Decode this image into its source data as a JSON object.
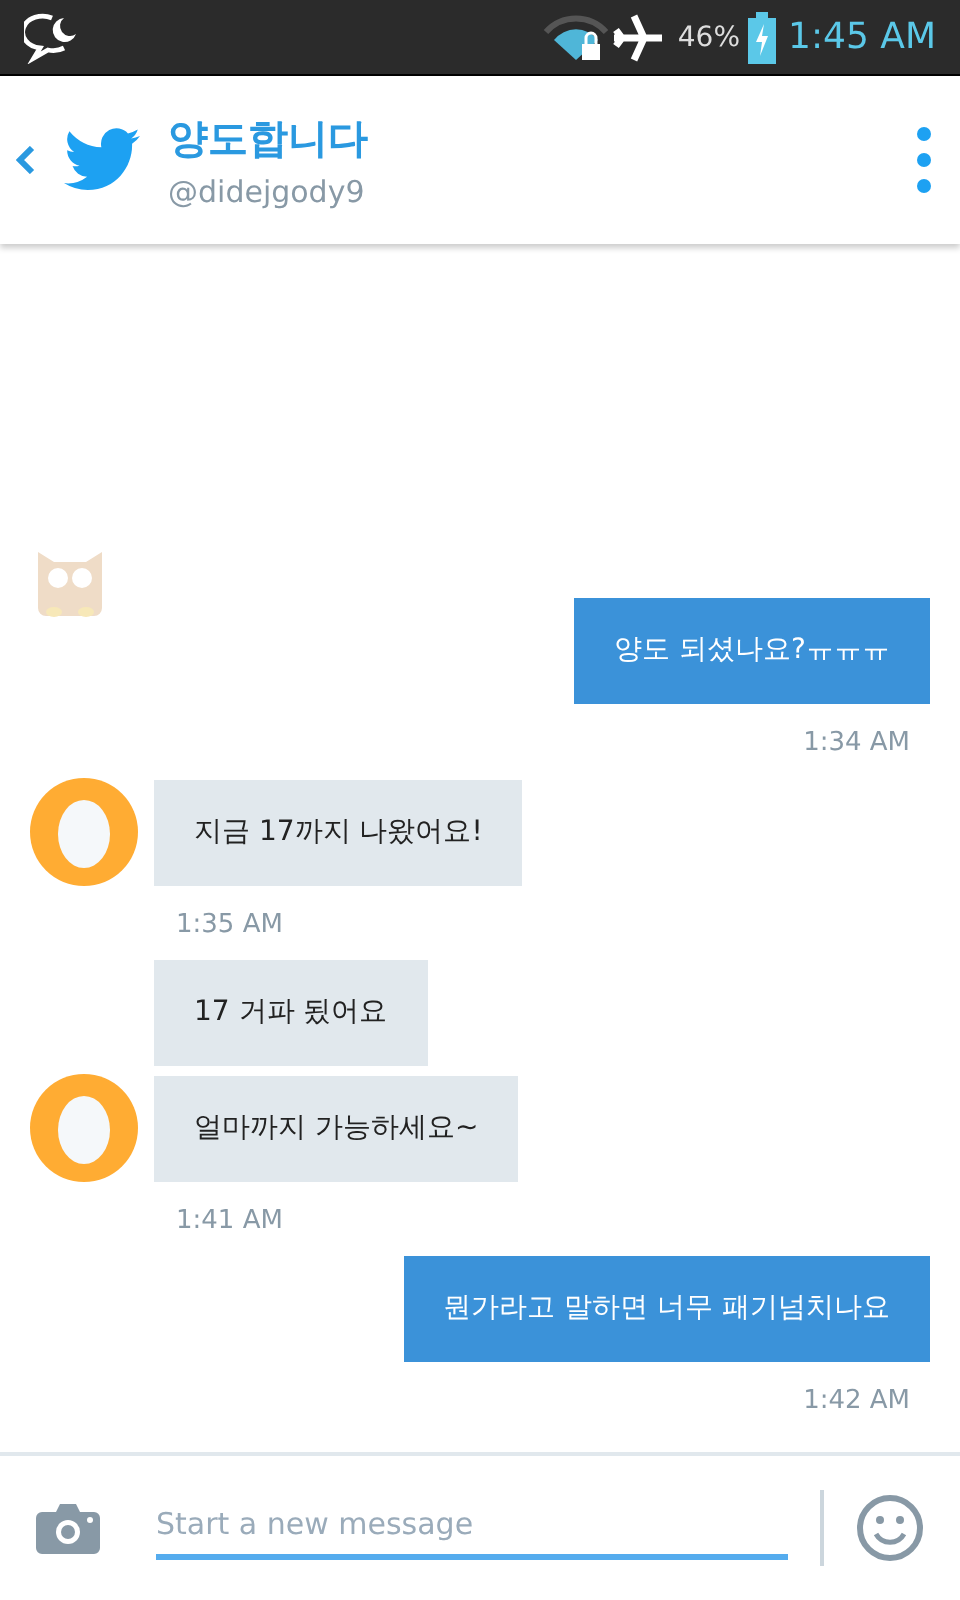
{
  "status_bar": {
    "battery": "46%",
    "time": "1:45 AM"
  },
  "header": {
    "title": "양도합니다",
    "handle": "@didejgody9"
  },
  "messages": [
    {
      "kind": "sent",
      "text": "양도 되셨나요?ㅠㅠㅠ",
      "time": "1:34 AM"
    },
    {
      "kind": "received",
      "text": "지금 17까지 나왔어요!",
      "time": "1:35 AM",
      "show_avatar": true
    },
    {
      "kind": "received",
      "text": "17 거파 됬어요",
      "show_avatar": false
    },
    {
      "kind": "received",
      "text": "얼마까지 가능하세요~",
      "time": "1:41 AM",
      "show_avatar": true
    },
    {
      "kind": "sent",
      "text": "뭔가라고 말하면 너무 패기넘치나요",
      "time": "1:42 AM"
    }
  ],
  "composer": {
    "placeholder": "Start a new message"
  }
}
